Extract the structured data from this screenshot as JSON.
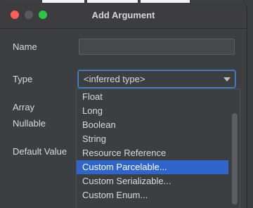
{
  "dialog": {
    "title": "Add Argument"
  },
  "form": {
    "name_label": "Name",
    "name_value": "",
    "type_label": "Type",
    "type_value": "<inferred type>",
    "array_label": "Array",
    "nullable_label": "Nullable",
    "default_value_label": "Default Value"
  },
  "type_dropdown": {
    "options": [
      "Float",
      "Long",
      "Boolean",
      "String",
      "Resource Reference",
      "Custom Parcelable...",
      "Custom Serializable...",
      "Custom Enum..."
    ],
    "highlighted": "Custom Parcelable..."
  },
  "colors": {
    "close": "#ff5f57",
    "maximize": "#2ac840",
    "selection": "#2f65ca",
    "focus_border": "#4a88c7"
  }
}
